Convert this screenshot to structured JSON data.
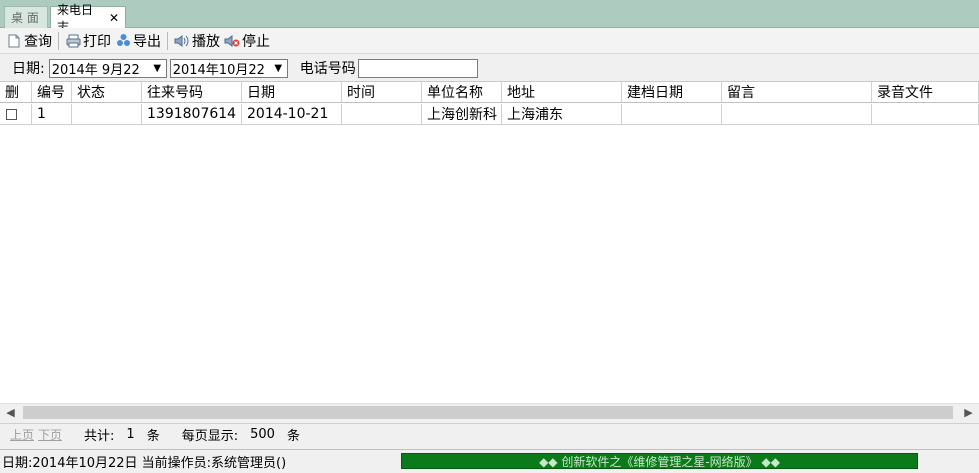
{
  "tabs": [
    {
      "label": "桌 面",
      "active": false
    },
    {
      "label": "来电日志",
      "active": true
    }
  ],
  "toolbar": {
    "query": "查询",
    "print": "打印",
    "export": "导出",
    "play": "播放",
    "stop": "停止"
  },
  "filter": {
    "date_label": "日期:",
    "date_from": "2014年 9月22",
    "date_to": "2014年10月22",
    "phone_label": "电话号码",
    "phone_value": ""
  },
  "table": {
    "columns": [
      "删",
      "编号",
      "状态",
      "往来号码",
      "日期",
      "时间",
      "单位名称",
      "地址",
      "建档日期",
      "留言",
      "录音文件"
    ],
    "rows": [
      {
        "del": "",
        "no": "1",
        "status": "",
        "phone": "1391807614",
        "date": "2014-10-21",
        "time": "",
        "unit": "上海创新科",
        "address": "上海浦东",
        "created": "",
        "message": "",
        "recording": ""
      }
    ]
  },
  "pager": {
    "prev": "上页",
    "next": "下页",
    "total_label": "共计:",
    "total_count": "1",
    "total_unit": "条",
    "per_page_label": "每页显示:",
    "per_page": "500",
    "per_page_unit": "条"
  },
  "status": {
    "text": "日期:2014年10月22日 当前操作员:系统管理员()",
    "banner": "◆◆ 创新软件之《维修管理之星-网络版》 ◆◆"
  },
  "colors": {
    "tabbar": "#aecbbf",
    "banner": "#0a7a1a"
  }
}
